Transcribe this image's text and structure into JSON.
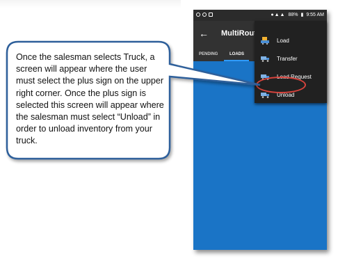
{
  "status_bar": {
    "battery": "88%",
    "time": "9:55 AM"
  },
  "app_bar": {
    "title": "MultiRoute"
  },
  "tabs": [
    {
      "label": "PENDING"
    },
    {
      "label": "LOADS"
    }
  ],
  "menu": {
    "items": [
      {
        "label": "Load",
        "icon": "load-icon"
      },
      {
        "label": "Transfer",
        "icon": "transfer-truck-icon"
      },
      {
        "label": "Load Request",
        "icon": "load-request-truck-icon"
      },
      {
        "label": "Unload",
        "icon": "unload-truck-icon"
      }
    ]
  },
  "callout": {
    "text": "Once the salesman selects Truck, a screen will appear where the user must select the plus sign on the upper right corner. Once the plus sign is selected this screen will appear where the salesman must select “Unload”  in order to unload inventory from your truck."
  },
  "colors": {
    "app_blue": "#1a74c6",
    "app_bar": "#323232",
    "menu_bg": "#212121",
    "highlight": "#d9443d",
    "callout_border": "#2d5f9a"
  }
}
